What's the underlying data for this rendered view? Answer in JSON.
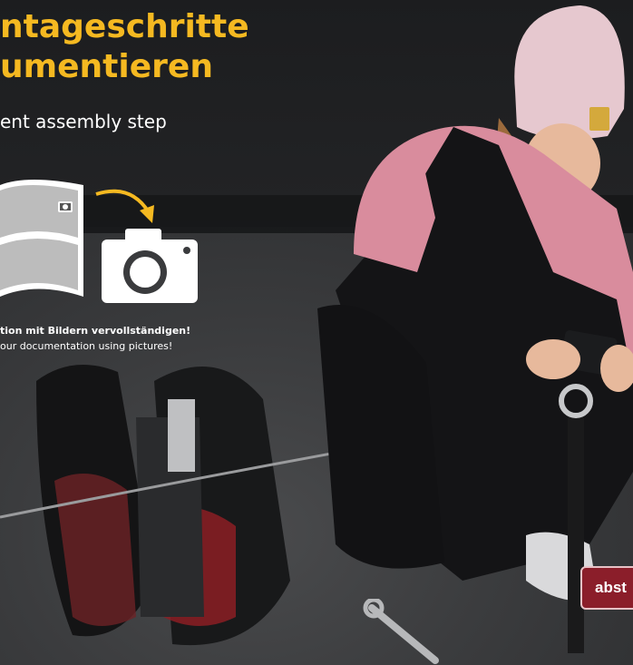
{
  "header": {
    "title_line1": "ntageschritte",
    "title_line2": "umentieren",
    "subtitle": "ent assembly step"
  },
  "captions": {
    "german": "tion mit Bildern vervollständigen!",
    "english": "our documentation using pictures!"
  },
  "badge": {
    "label": "abst"
  },
  "icons": {
    "document": "photo-document-icon",
    "arrow": "curved-arrow-icon",
    "camera": "camera-icon"
  },
  "colors": {
    "title": "#f5b921",
    "badge": "#8b1e2a",
    "arrow": "#f5b921"
  }
}
